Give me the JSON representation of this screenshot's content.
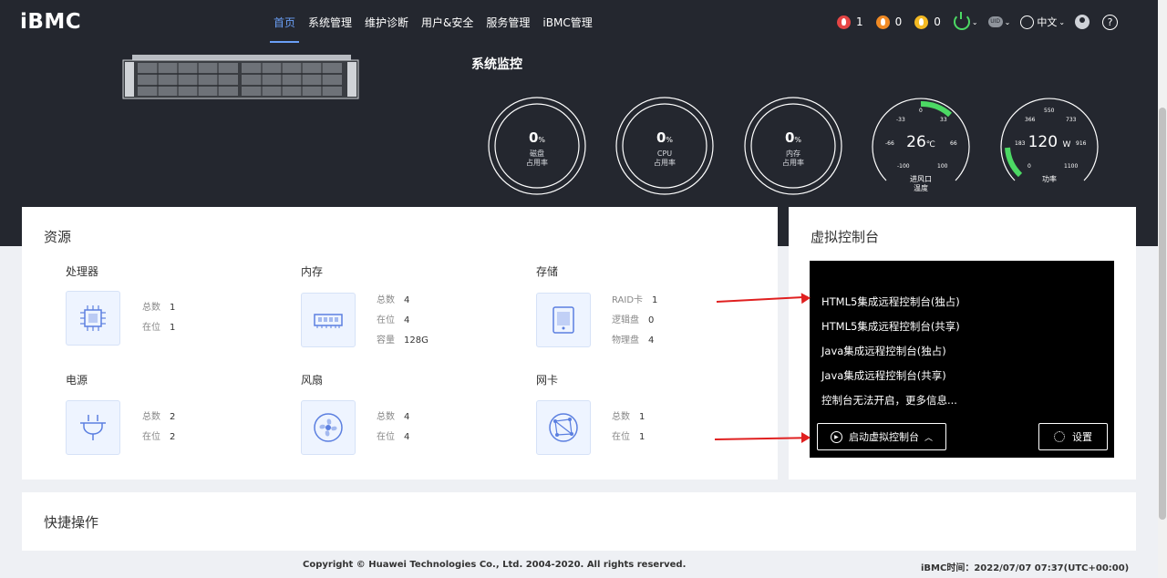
{
  "app": {
    "logo": "iBMC"
  },
  "nav": {
    "items": [
      "首页",
      "系统管理",
      "维护诊断",
      "用户&安全",
      "服务管理",
      "iBMC管理"
    ],
    "active": 0
  },
  "header": {
    "alerts": [
      {
        "type": "critical",
        "count": "1",
        "color": "#e54545"
      },
      {
        "type": "major",
        "count": "0",
        "color": "#f08a24"
      },
      {
        "type": "minor",
        "count": "0",
        "color": "#f3b922"
      }
    ],
    "uid_label": "UID",
    "language": "中文",
    "help": "?"
  },
  "monitor": {
    "title": "系统监控",
    "disk": {
      "value": "0",
      "unit": "%",
      "label1": "磁盘",
      "label2": "占用率"
    },
    "cpu": {
      "value": "0",
      "unit": "%",
      "label1": "CPU",
      "label2": "占用率"
    },
    "memory": {
      "value": "0",
      "unit": "%",
      "label1": "内存",
      "label2": "占用率"
    },
    "inlet": {
      "value": "26",
      "unit": "℃",
      "label1": "进风口",
      "label2": "温度",
      "ticks": [
        "0",
        "-33",
        "33",
        "-66",
        "66",
        "-100",
        "100"
      ]
    },
    "power": {
      "value": "120",
      "unit": "W",
      "label": "功率",
      "ticks": [
        "550",
        "366",
        "733",
        "183",
        "916",
        "0",
        "1100"
      ]
    }
  },
  "resources": {
    "title": "资源",
    "processor": {
      "title": "处理器",
      "rows": [
        {
          "k": "总数",
          "v": "1"
        },
        {
          "k": "在位",
          "v": "1"
        }
      ]
    },
    "memory": {
      "title": "内存",
      "rows": [
        {
          "k": "总数",
          "v": "4"
        },
        {
          "k": "在位",
          "v": "4"
        },
        {
          "k": "容量",
          "v": "128G"
        }
      ]
    },
    "storage": {
      "title": "存储",
      "rows": [
        {
          "k": "RAID卡",
          "v": "1"
        },
        {
          "k": "逻辑盘",
          "v": "0"
        },
        {
          "k": "物理盘",
          "v": "4"
        }
      ]
    },
    "power": {
      "title": "电源",
      "rows": [
        {
          "k": "总数",
          "v": "2"
        },
        {
          "k": "在位",
          "v": "2"
        }
      ]
    },
    "fan": {
      "title": "风扇",
      "rows": [
        {
          "k": "总数",
          "v": "4"
        },
        {
          "k": "在位",
          "v": "4"
        }
      ]
    },
    "nic": {
      "title": "网卡",
      "rows": [
        {
          "k": "总数",
          "v": "1"
        },
        {
          "k": "在位",
          "v": "1"
        }
      ]
    }
  },
  "console": {
    "title": "虚拟控制台",
    "menu": [
      "HTML5集成远程控制台(独占)",
      "HTML5集成远程控制台(共享)",
      "Java集成远程控制台(独占)",
      "Java集成远程控制台(共享)",
      "控制台无法开启，更多信息..."
    ],
    "launch_label": "启动虚拟控制台",
    "settings_label": "设置"
  },
  "quick": {
    "title": "快捷操作"
  },
  "footer": {
    "copyright": "Copyright © Huawei Technologies Co., Ltd. 2004-2020. All rights reserved.",
    "time_label": "iBMC时间：",
    "time": "2022/07/07 07:37(UTC+00:00)"
  }
}
